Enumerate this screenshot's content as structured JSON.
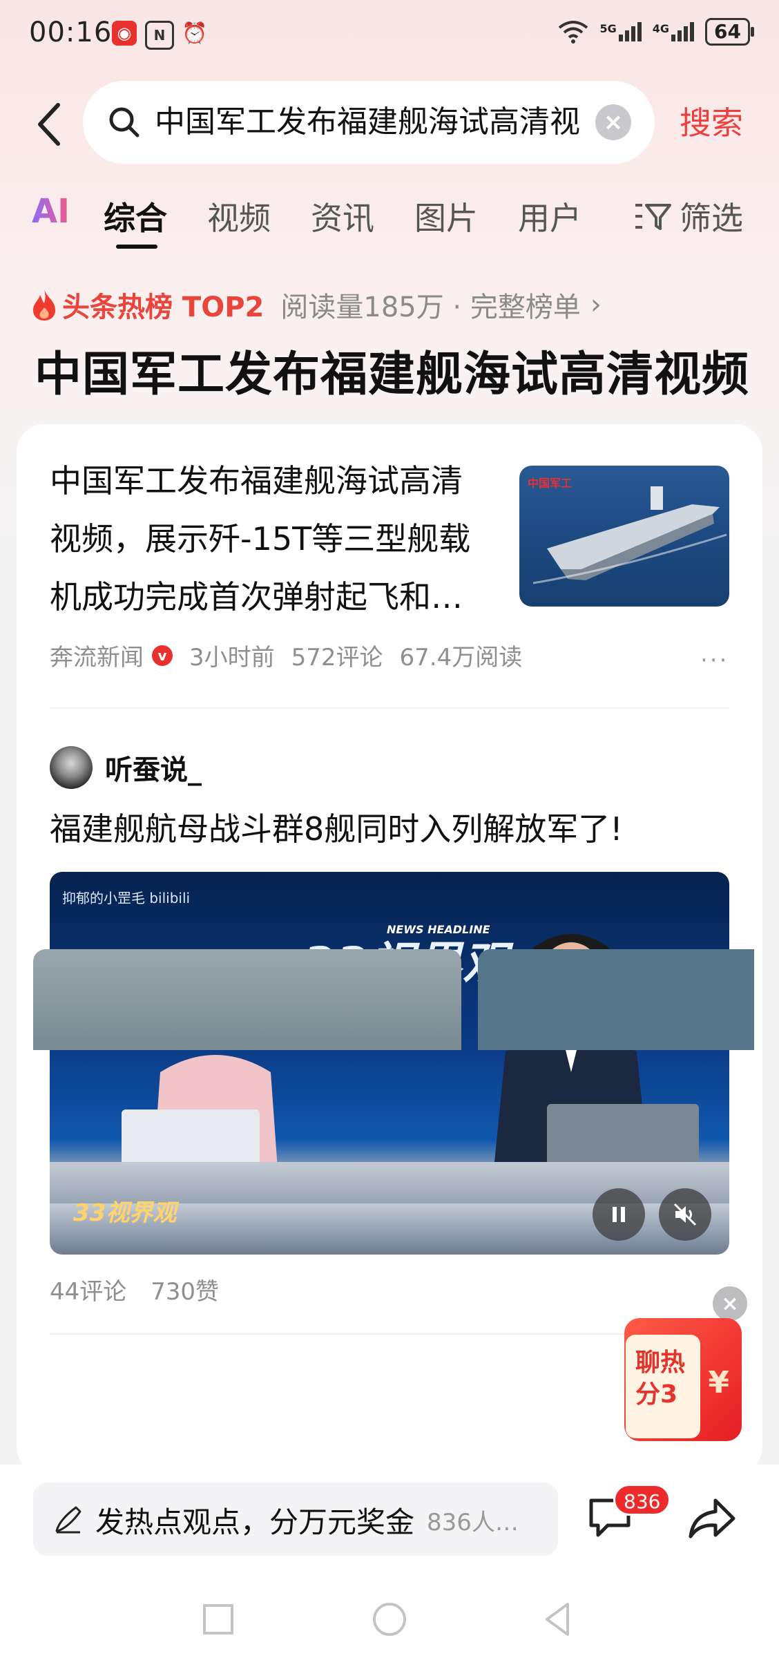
{
  "status_bar": {
    "time": "00:16",
    "network_5g": "5G",
    "network_4g": "4G",
    "battery": "64"
  },
  "search": {
    "query": "中国军工发布福建舰海试高清视",
    "button": "搜索"
  },
  "tabs": [
    {
      "label": "AI"
    },
    {
      "label": "综合"
    },
    {
      "label": "视频"
    },
    {
      "label": "资讯"
    },
    {
      "label": "图片"
    },
    {
      "label": "用户"
    }
  ],
  "filter_label": "筛选",
  "hot_list": {
    "label": "头条热榜 TOP2",
    "meta": "阅读量185万 · 完整榜单",
    "headline": "中国军工发布福建舰海试高清视频"
  },
  "article1": {
    "title_lines": [
      "中国军工发布福建舰海试高清",
      "视频，展示歼-15T等三型舰载",
      "机成功完成首次弹射起飞和…"
    ],
    "thumb_label": "中国军工",
    "source": "奔流新闻",
    "time": "3小时前",
    "comments": "572评论",
    "reads": "67.4万阅读"
  },
  "article2": {
    "author": "听蚕说_",
    "title": "福建舰航母战斗群8舰同时入列解放军了!",
    "video_watermark": "抑郁的小罡毛 bilibili",
    "video_logo": "33视界观",
    "video_logo_sub": "NEWS HEADLINE",
    "comments": "44评论",
    "likes": "730赞"
  },
  "packet": {
    "line1": "聊热",
    "line2": "分3",
    "symbol": "¥"
  },
  "bottom": {
    "comment_prompt": "发热点观点，分万元奖金",
    "participants": "836人…",
    "message_badge": "836"
  },
  "colors": {
    "accent_red": "#ee3f3f",
    "background_top": "#f9e6e6"
  }
}
